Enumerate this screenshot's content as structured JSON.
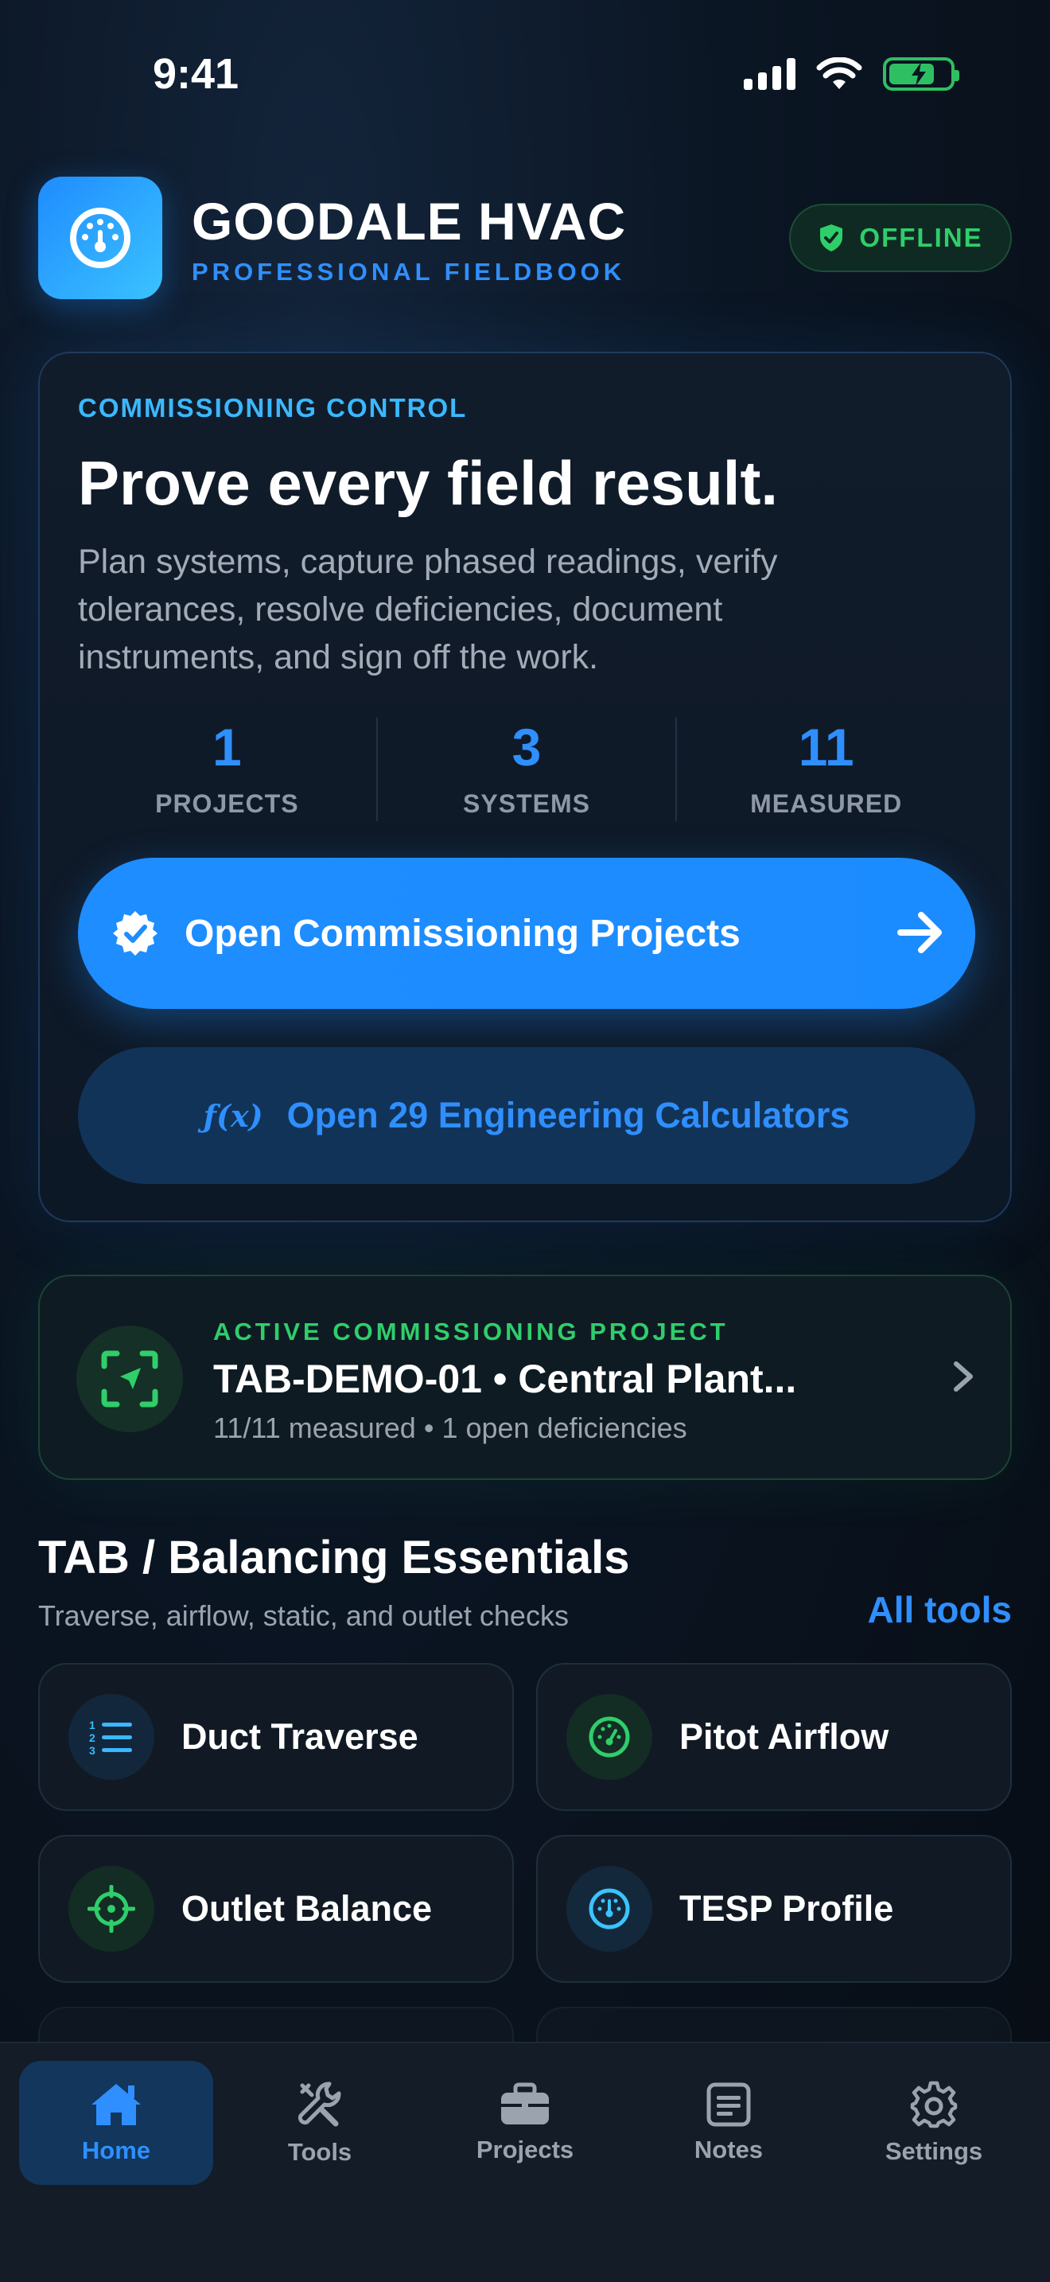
{
  "status_bar": {
    "time": "9:41"
  },
  "header": {
    "title": "GOODALE HVAC",
    "subtitle": "PROFESSIONAL FIELDBOOK",
    "badge": "OFFLINE"
  },
  "hero": {
    "eyebrow": "COMMISSIONING CONTROL",
    "title": "Prove every field result.",
    "description": "Plan systems, capture phased readings, verify tolerances, resolve deficiencies, document instruments, and sign off the work.",
    "stats": [
      {
        "value": "1",
        "label": "PROJECTS"
      },
      {
        "value": "3",
        "label": "SYSTEMS"
      },
      {
        "value": "11",
        "label": "MEASURED"
      }
    ],
    "primary_button": "Open Commissioning Projects",
    "secondary_button_icon": "ƒ(x)",
    "secondary_button": "Open 29 Engineering Calculators"
  },
  "active_project": {
    "eyebrow": "ACTIVE COMMISSIONING PROJECT",
    "title": "TAB-DEMO-01 • Central Plant...",
    "meta": "11/11 measured • 1 open deficiencies"
  },
  "section": {
    "title": "TAB / Balancing Essentials",
    "subtitle": "Traverse, airflow, static, and outlet checks",
    "link": "All tools",
    "tools": [
      {
        "label": "Duct Traverse",
        "icon": "numbered-list-icon"
      },
      {
        "label": "Pitot Airflow",
        "icon": "gauge-icon"
      },
      {
        "label": "Outlet Balance",
        "icon": "crosshair-icon"
      },
      {
        "label": "TESP Profile",
        "icon": "gauge-icon"
      }
    ]
  },
  "tab_bar": {
    "tabs": [
      {
        "label": "Home",
        "icon": "home-icon",
        "active": true
      },
      {
        "label": "Tools",
        "icon": "tools-icon",
        "active": false
      },
      {
        "label": "Projects",
        "icon": "briefcase-icon",
        "active": false
      },
      {
        "label": "Notes",
        "icon": "notes-icon",
        "active": false
      },
      {
        "label": "Settings",
        "icon": "gear-icon",
        "active": false
      }
    ]
  },
  "colors": {
    "accent": "#2f8fff",
    "success": "#2fce6b",
    "background": "#0b1624"
  }
}
